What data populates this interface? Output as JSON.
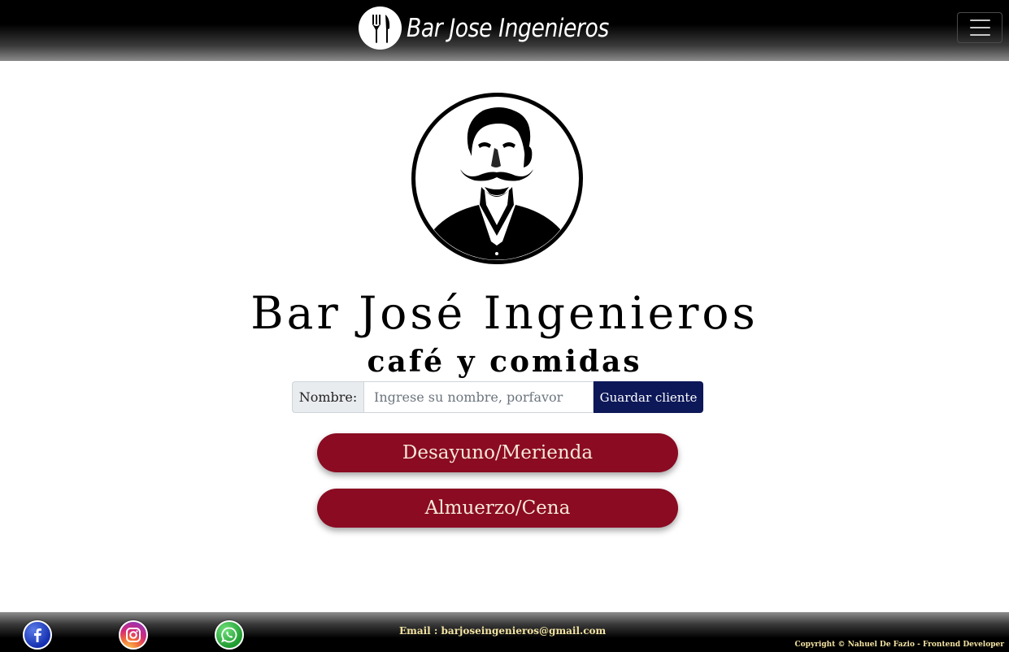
{
  "header": {
    "brand_name": "Bar Jose Ingenieros",
    "logo_icon": "fork-knife-icon",
    "menu_icon": "hamburger-menu-icon"
  },
  "hero": {
    "portrait": "jose-ingenieros-portrait",
    "title": "Bar José Ingenieros",
    "subtitle": "café y comidas"
  },
  "customer_form": {
    "label": "Nombre:",
    "placeholder": "Ingrese su nombre, porfavor",
    "value": "",
    "submit_label": "Guardar cliente"
  },
  "menu_buttons": [
    {
      "label": "Desayuno/Merienda"
    },
    {
      "label": "Almuerzo/Cena"
    }
  ],
  "footer": {
    "social": [
      "facebook-icon",
      "instagram-icon",
      "whatsapp-icon"
    ],
    "email": "Email : barjoseingenieros@gmail.com",
    "copyright": "Copyright © Nahuel De Fazio - Frontend Developer"
  },
  "colors": {
    "button_primary": "#8a0b22",
    "button_text": "#f6e8d6",
    "save_button": "#0d1858",
    "footer_text": "#f3e3a3"
  }
}
